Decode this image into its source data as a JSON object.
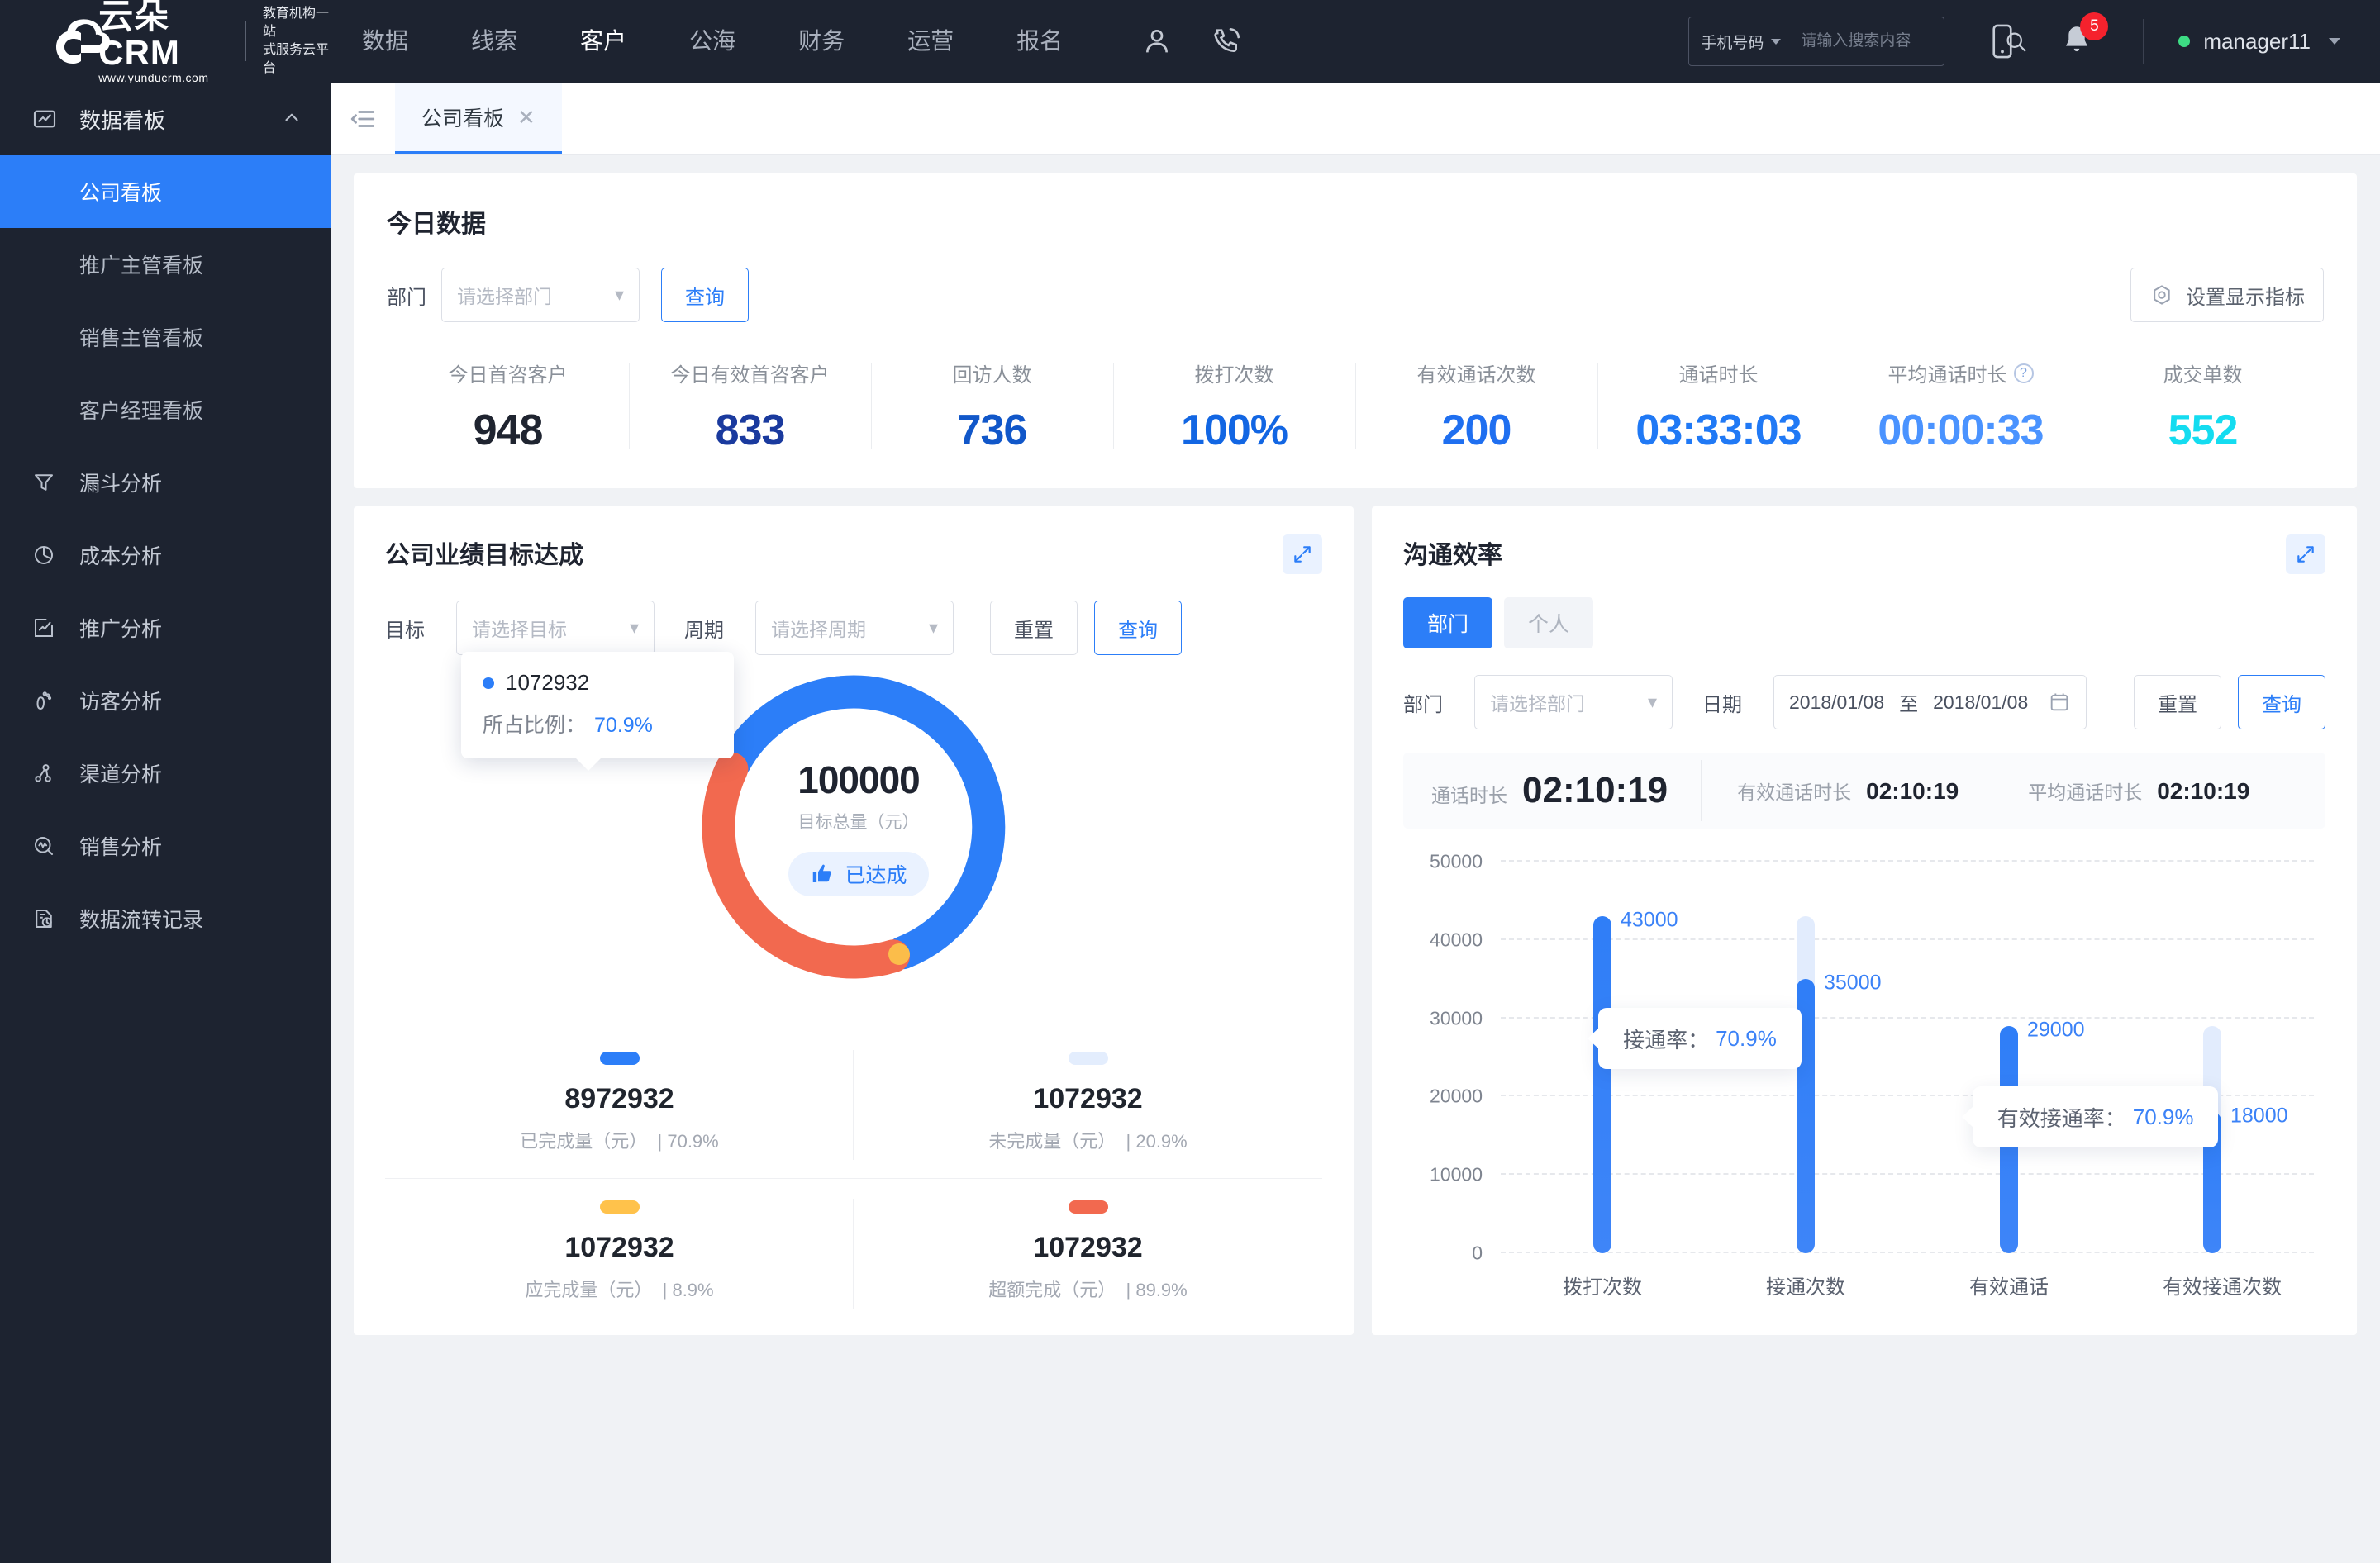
{
  "brand": {
    "name": "云朵CRM",
    "url": "www.yunducrm.com",
    "tagline_line1": "教育机构一站",
    "tagline_line2": "式服务云平台"
  },
  "topnav": {
    "items": [
      {
        "label": "数据",
        "active": false
      },
      {
        "label": "线索",
        "active": false
      },
      {
        "label": "客户",
        "active": true
      },
      {
        "label": "公海",
        "active": false
      },
      {
        "label": "财务",
        "active": false
      },
      {
        "label": "运营",
        "active": false
      },
      {
        "label": "报名",
        "active": false
      }
    ],
    "icons": [
      "user-icon",
      "phone-call-icon"
    ]
  },
  "search": {
    "type_label": "手机号码",
    "placeholder": "请输入搜索内容",
    "value": ""
  },
  "notifications": {
    "count": "5"
  },
  "user": {
    "name": "manager11",
    "status_color": "#3ddc84"
  },
  "sidebar": {
    "group": {
      "label": "数据看板",
      "icon": "dashboard-icon",
      "expanded": true
    },
    "subitems": [
      {
        "label": "公司看板",
        "active": true
      },
      {
        "label": "推广主管看板",
        "active": false
      },
      {
        "label": "销售主管看板",
        "active": false
      },
      {
        "label": "客户经理看板",
        "active": false
      }
    ],
    "items": [
      {
        "label": "漏斗分析",
        "icon": "funnel-icon"
      },
      {
        "label": "成本分析",
        "icon": "pie-icon"
      },
      {
        "label": "推广分析",
        "icon": "trend-box-icon"
      },
      {
        "label": "访客分析",
        "icon": "footprint-icon"
      },
      {
        "label": "渠道分析",
        "icon": "share-nodes-icon"
      },
      {
        "label": "销售分析",
        "icon": "pulse-search-icon"
      },
      {
        "label": "数据流转记录",
        "icon": "doc-clock-icon"
      }
    ]
  },
  "tabbar": {
    "collapse_icon": "collapse-menu-icon",
    "tabs": [
      {
        "label": "公司看板",
        "closable": true,
        "active": true
      }
    ]
  },
  "today": {
    "title": "今日数据",
    "dept_label": "部门",
    "dept_placeholder": "请选择部门",
    "query_label": "查询",
    "settings_label": "设置显示指标",
    "kpis": [
      {
        "label": "今日首咨客户",
        "value": "948",
        "color": "#1f2430",
        "hint": false
      },
      {
        "label": "今日有效首咨客户",
        "value": "833",
        "color": "#1a3a9e",
        "hint": false
      },
      {
        "label": "回访人数",
        "value": "736",
        "color": "#1157c9",
        "hint": false
      },
      {
        "label": "拨打次数",
        "value": "100%",
        "color": "#1266e3",
        "hint": false
      },
      {
        "label": "有效通话次数",
        "value": "200",
        "color": "#1f6ff0",
        "hint": false
      },
      {
        "label": "通话时长",
        "value": "03:33:03",
        "color": "#2079f5",
        "hint": false
      },
      {
        "label": "平均通话时长",
        "value": "00:00:33",
        "color": "#4a93ff",
        "hint": true
      },
      {
        "label": "成交单数",
        "value": "552",
        "color": "#14dcf0",
        "hint": false
      }
    ]
  },
  "goal_panel": {
    "title": "公司业绩目标达成",
    "expand_icon": "expand-icon",
    "goal_label": "目标",
    "goal_placeholder": "请选择目标",
    "period_label": "周期",
    "period_placeholder": "请选择周期",
    "reset_label": "重置",
    "query_label": "查询",
    "tooltip": {
      "value": "1072932",
      "ratio_label": "所占比例：",
      "ratio_value": "70.9%"
    },
    "center": {
      "total": "100000",
      "total_label": "目标总量（元）",
      "badge": "已达成",
      "badge_icon": "thumb-up-icon"
    },
    "legend": [
      {
        "value": "8972932",
        "label": "已完成量（元）",
        "pct": "70.9%",
        "color": "#2c7ef8"
      },
      {
        "value": "1072932",
        "label": "未完成量（元）",
        "pct": "20.9%",
        "color": "#e3edfd"
      },
      {
        "value": "1072932",
        "label": "应完成量（元）",
        "pct": "8.9%",
        "color": "#ffc24b"
      },
      {
        "value": "1072932",
        "label": "超额完成（元）",
        "pct": "89.9%",
        "color": "#f2694f"
      }
    ]
  },
  "comm_panel": {
    "title": "沟通效率",
    "expand_icon": "expand-icon",
    "segments": [
      {
        "label": "部门",
        "active": true
      },
      {
        "label": "个人",
        "active": false
      }
    ],
    "dept_label": "部门",
    "dept_placeholder": "请选择部门",
    "date_label": "日期",
    "date_from": "2018/01/08",
    "date_sep": "至",
    "date_to": "2018/01/08",
    "calendar_icon": "calendar-icon",
    "reset_label": "重置",
    "query_label": "查询",
    "durations": [
      {
        "label": "通话时长",
        "value": "02:10:19",
        "size": "big"
      },
      {
        "label": "有效通话时长",
        "value": "02:10:19",
        "size": "small"
      },
      {
        "label": "平均通话时长",
        "value": "02:10:19",
        "size": "small"
      }
    ],
    "tooltips": [
      {
        "label": "接通率：",
        "value": "70.9%"
      },
      {
        "label": "有效接通率：",
        "value": "70.9%"
      }
    ]
  },
  "chart_data": {
    "type": "bar",
    "title": "沟通效率",
    "categories": [
      "拨打次数",
      "接通次数",
      "有效通话",
      "有效接通次数"
    ],
    "values": [
      43000,
      35000,
      29000,
      18000
    ],
    "value_labels": [
      "43000",
      "35000",
      "29000",
      "18000"
    ],
    "tracks": [
      43000,
      43000,
      29000,
      29000
    ],
    "yticks": [
      0,
      10000,
      20000,
      30000,
      40000,
      50000
    ],
    "ytick_labels": [
      "0",
      "10000",
      "20000",
      "30000",
      "40000",
      "50000"
    ],
    "ylim": [
      0,
      50000
    ],
    "xlabel": "",
    "ylabel": "",
    "grid": true,
    "legend": "none",
    "series_color": "#2f7ef7",
    "track_color": "#e2ecfd",
    "annotations": [
      {
        "text": "接通率：70.9%",
        "near_category": "接通次数"
      },
      {
        "text": "有效接通率：70.9%",
        "near_category": "有效接通次数"
      }
    ]
  }
}
